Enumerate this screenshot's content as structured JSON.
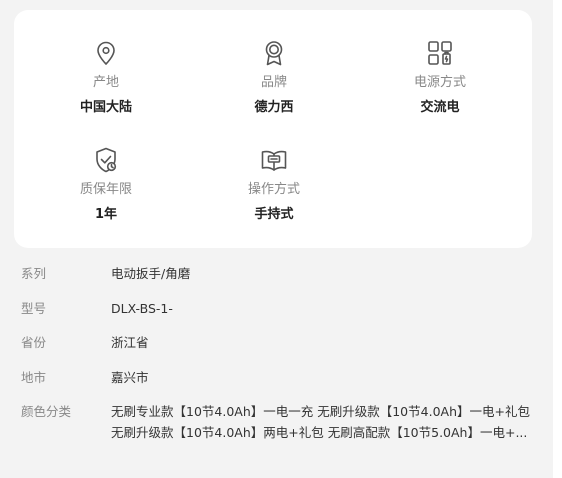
{
  "features": [
    {
      "icon": "location-pin-icon",
      "label": "产地",
      "value": "中国大陆"
    },
    {
      "icon": "award-badge-icon",
      "label": "品牌",
      "value": "德力西"
    },
    {
      "icon": "power-grid-icon",
      "label": "电源方式",
      "value": "交流电"
    },
    {
      "icon": "shield-check-icon",
      "label": "质保年限",
      "value": "1年"
    },
    {
      "icon": "manual-book-icon",
      "label": "操作方式",
      "value": "手持式"
    }
  ],
  "properties": [
    {
      "label": "系列",
      "value": "电动扳手/角磨"
    },
    {
      "label": "型号",
      "value": "DLX-BS-1-"
    },
    {
      "label": "省份",
      "value": "浙江省"
    },
    {
      "label": "地市",
      "value": "嘉兴市"
    },
    {
      "label": "颜色分类",
      "lines": [
        "无刷专业款【10节4.0Ah】一电一充 无刷升级款【10节4.0Ah】一电+礼包",
        "无刷升级款【10节4.0Ah】两电+礼包 无刷高配款【10节5.0Ah】一电+..."
      ]
    }
  ],
  "colors": {
    "background": "#f3f3f3",
    "card": "#ffffff",
    "label": "#888888",
    "value": "#222222",
    "icon": "#555555"
  }
}
